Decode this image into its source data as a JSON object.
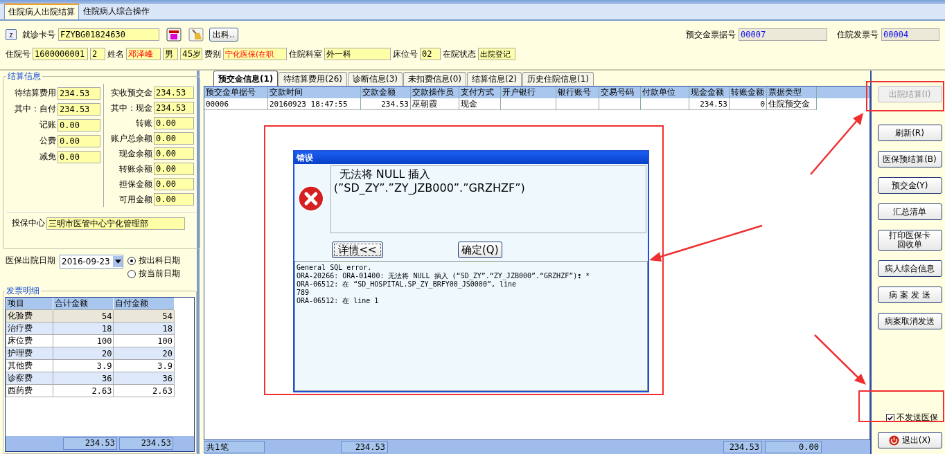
{
  "tabs": [
    {
      "label": "住院病人出院结算",
      "selected": true
    },
    {
      "label": "住院病人综合操作",
      "selected": false
    }
  ],
  "header": {
    "z_button": "z",
    "card_label": "就诊卡号",
    "card_no": "FZYBG01824630",
    "discharge_button": "出科..",
    "receipt_label": "预交金票据号",
    "receipt_no": "00007",
    "invoice_label": "住院发票号",
    "invoice_no": "00004"
  },
  "patient": [
    {
      "label": "住院号",
      "value": "1600000001",
      "alert": false
    },
    {
      "value": "2",
      "alert": false
    },
    {
      "label": "姓名",
      "value": "邓泽峰",
      "alert": true
    },
    {
      "value": "男",
      "alert": false
    },
    {
      "value": "45岁",
      "alert": false
    },
    {
      "label": "费别",
      "value": "宁化医保(在职",
      "alert": true
    },
    {
      "label": "住院科室",
      "value": "外一科",
      "alert": false
    },
    {
      "label": "床位号",
      "value": "02",
      "alert": false
    },
    {
      "label": "在院状态",
      "value": "出院登记",
      "alert": false
    }
  ],
  "settlement": {
    "title": "结算信息",
    "left": [
      {
        "label": "待结算费用",
        "value": "234.53"
      },
      {
        "label": "其中：自付",
        "value": "234.53"
      },
      {
        "label": "记账",
        "value": "0.00"
      },
      {
        "label": "公费",
        "value": "0.00"
      },
      {
        "label": "减免",
        "value": "0.00"
      }
    ],
    "right": [
      {
        "label": "实收预交金",
        "value": "234.53"
      },
      {
        "label": "其中：现金",
        "value": "234.53"
      },
      {
        "label": "转账",
        "value": "0.00"
      },
      {
        "label": "账户总余额",
        "value": "0.00"
      },
      {
        "label": "现金余额",
        "value": "0.00"
      },
      {
        "label": "转账余额",
        "value": "0.00"
      },
      {
        "label": "担保金额",
        "value": "0.00"
      },
      {
        "label": "可用金额",
        "value": "0.00"
      }
    ],
    "center_label": "投保中心",
    "center_value": "三明市医管中心宁化管理部"
  },
  "discharge_date": {
    "label": "医保出院日期",
    "value": "2016-09-23",
    "options": [
      {
        "label": "按出科日期",
        "selected": true
      },
      {
        "label": "按当前日期",
        "selected": false
      }
    ]
  },
  "invoice": {
    "title": "发票明细",
    "columns": [
      "项目",
      "合计金额",
      "自付金额"
    ],
    "rows": [
      {
        "cells": [
          "化验费",
          "54",
          "54"
        ],
        "selected": true
      },
      {
        "cells": [
          "治疗费",
          "18",
          "18"
        ],
        "selected": false
      },
      {
        "cells": [
          "床位费",
          "100",
          "100"
        ],
        "selected": false
      },
      {
        "cells": [
          "护理费",
          "20",
          "20"
        ],
        "selected": false
      },
      {
        "cells": [
          "其他费",
          "3.9",
          "3.9"
        ],
        "selected": false
      },
      {
        "cells": [
          "诊察费",
          "36",
          "36"
        ],
        "selected": false
      },
      {
        "cells": [
          "西药费",
          "2.63",
          "2.63"
        ],
        "selected": false
      }
    ],
    "totals": [
      "234.53",
      "234.53"
    ]
  },
  "detail_tabs": [
    {
      "label": "预交金信息(1)",
      "selected": true
    },
    {
      "label": "待结算费用(26)",
      "selected": false
    },
    {
      "label": "诊断信息(3)",
      "selected": false
    },
    {
      "label": "未扣费信息(0)",
      "selected": false
    },
    {
      "label": "结算信息(2)",
      "selected": false
    },
    {
      "label": "历史住院信息(1)",
      "selected": false
    }
  ],
  "grid": {
    "columns": [
      "预交金单据号",
      "交款时间",
      "交款金额",
      "交款操作员",
      "支付方式",
      "开户银行",
      "银行账号",
      "交易号码",
      "付款单位",
      "现金金额",
      "转账金额",
      "票据类型"
    ],
    "rows": [
      [
        "00006",
        "20160923 18:47:55",
        "234.53",
        "巫朝霞",
        "现金",
        "",
        "",
        "",
        "",
        "234.53",
        "0",
        "住院预交金"
      ]
    ],
    "footer": {
      "count": "共1笔",
      "amount": "234.53",
      "cash": "234.53",
      "transfer": "0.00"
    }
  },
  "dialog": {
    "title": "错误",
    "message": [
      "无法将 NULL 插入",
      "(”SD_ZY”.”ZY_JZB000”.”GRZHZF”)"
    ],
    "buttons": [
      "详情<<",
      "确定(Q)"
    ],
    "details": [
      "General SQL error.",
      "ORA-20266: ORA-01400: 无法将 NULL 插入 (“SD_ZY”.“ZY_JZB000”.“GRZHZF”)❢ *",
      "ORA-06512: 在 “SD_HOSPITAL.SP_ZY_BRFY00_JS0000”, line",
      "789",
      "ORA-06512: 在 line 1"
    ]
  },
  "actions": [
    {
      "label": "出院结算(I)",
      "disabled": true
    },
    {
      "label": "刷新(R)",
      "disabled": false
    },
    {
      "label": "医保预结算(B)",
      "disabled": false
    },
    {
      "label": "预交金(Y)",
      "disabled": false
    },
    {
      "label": "汇总清单",
      "disabled": false
    },
    {
      "label": "打印医保卡回收单",
      "disabled": false
    },
    {
      "label": "病人综合信息",
      "disabled": false
    },
    {
      "label": "病 案 发 送",
      "disabled": false
    },
    {
      "label": "病案取消发送",
      "disabled": false
    }
  ],
  "no_insurance": {
    "label": "不发送医保",
    "checked": true
  },
  "exit_button": "退出(X)"
}
